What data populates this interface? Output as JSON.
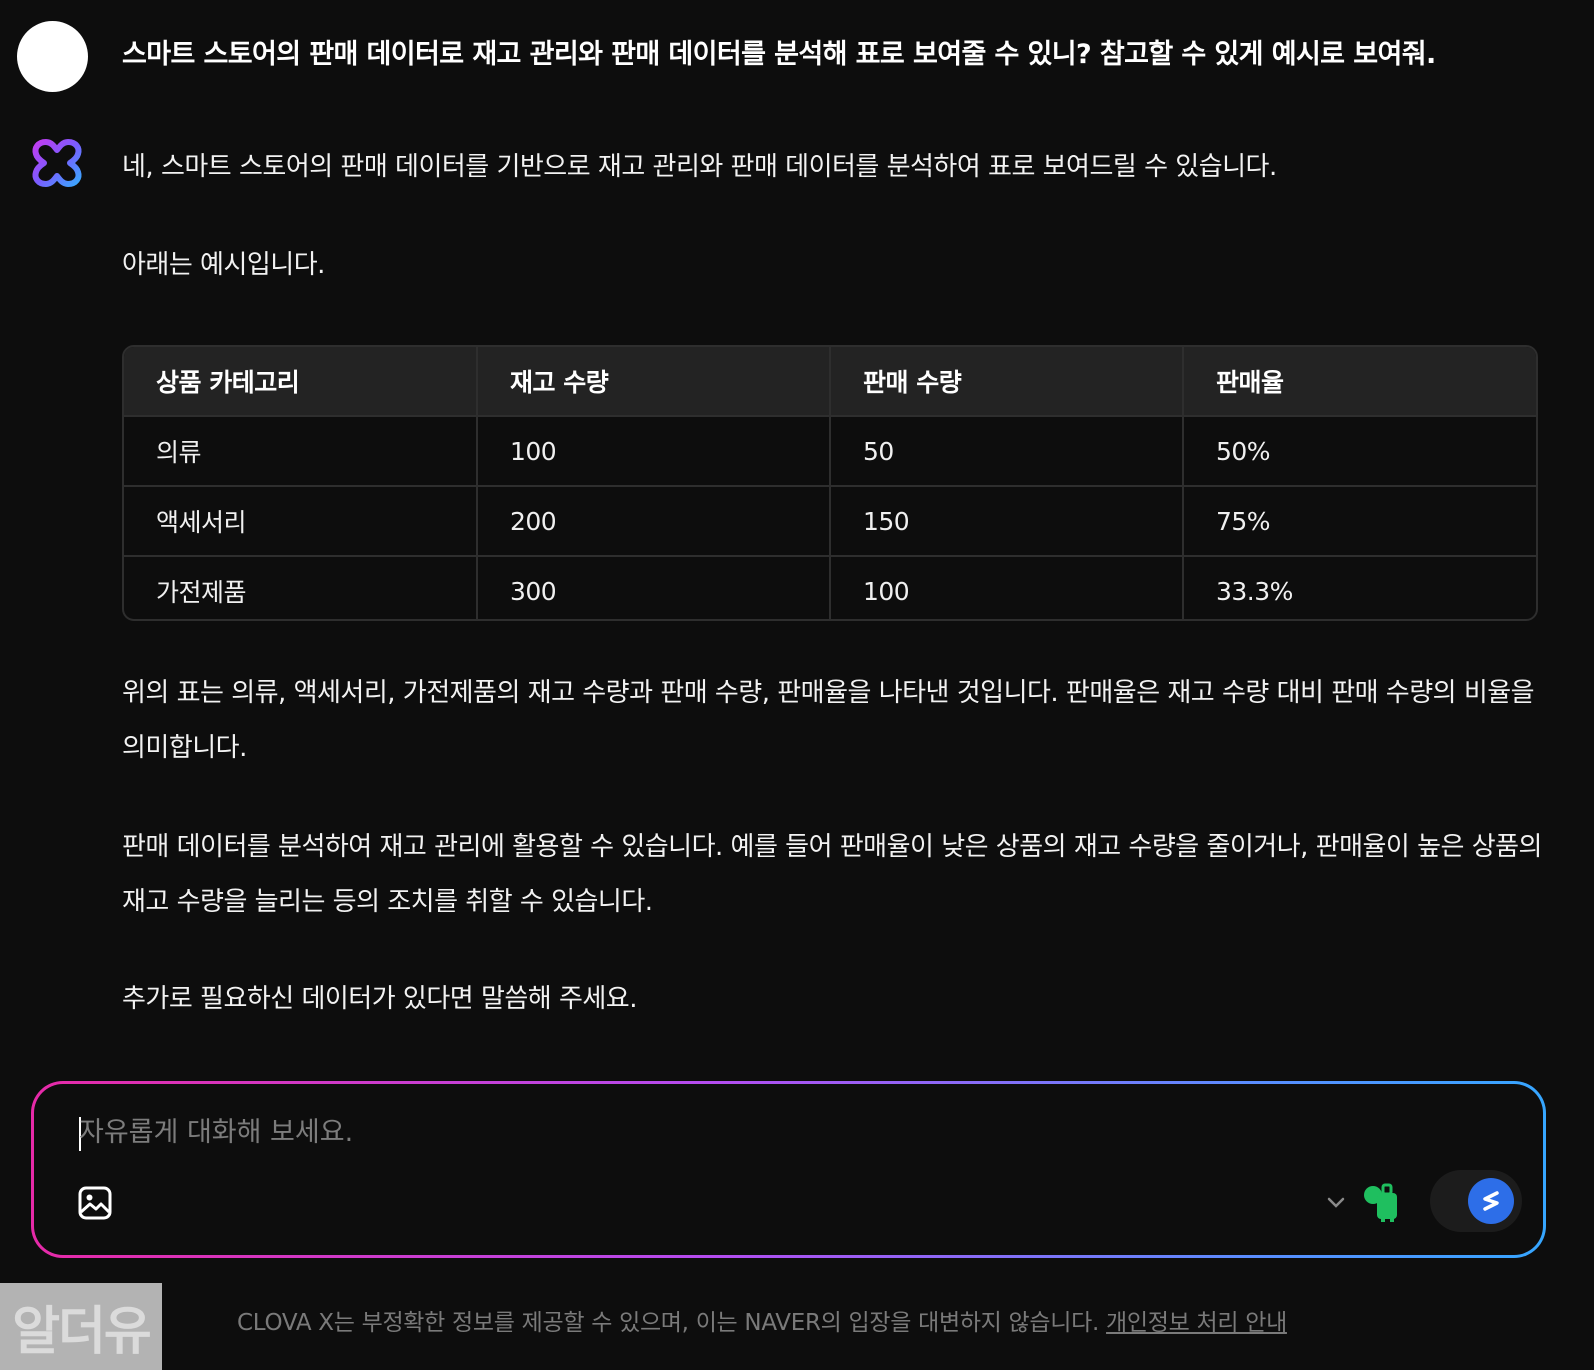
{
  "user_message": "스마트 스토어의 판매 데이터로 재고 관리와 판매 데이터를 분석해 표로 보여줄 수 있니? 참고할 수 있게 예시로 보여줘.",
  "response": {
    "intro": "네, 스마트 스토어의 판매 데이터를 기반으로 재고 관리와 판매 데이터를 분석하여 표로 보여드릴 수 있습니다.",
    "example": "아래는 예시입니다.",
    "table": {
      "headers": [
        "상품 카테고리",
        "재고 수량",
        "판매 수량",
        "판매율"
      ],
      "rows": [
        [
          "의류",
          "100",
          "50",
          "50%"
        ],
        [
          "액세서리",
          "200",
          "150",
          "75%"
        ],
        [
          "가전제품",
          "300",
          "100",
          "33.3%"
        ]
      ]
    },
    "description": "위의 표는 의류, 액세서리, 가전제품의 재고 수량과 판매 수량, 판매율을 나타낸 것입니다. 판매율은 재고 수량 대비 판매 수량의 비율을 의미합니다.",
    "usage": "판매 데이터를 분석하여 재고 관리에 활용할 수 있습니다. 예를 들어 판매율이 낮은 상품의 재고 수량을 줄이거나, 판매율이 높은 상품의 재고 수량을 늘리는 등의 조치를 취할 수 있습니다.",
    "extra": "추가로 필요하신 데이터가 있다면 말씀해 주세요."
  },
  "input": {
    "placeholder": "자유롭게 대화해 보세요.",
    "value": ""
  },
  "icons": {
    "image": "image-icon",
    "chevron": "chevron-down-icon",
    "skill": "skill-plugin-icon",
    "send": "send-icon",
    "logo": "clova-x-logo-icon"
  },
  "colors": {
    "background": "#0d0d0d",
    "table_border": "#2e2e2e",
    "table_header_bg": "#232323",
    "input_gradient_start": "#e62aa8",
    "input_gradient_end": "#36a6ff",
    "send_button": "#2d6ee8",
    "skill_icon": "#1fbf5f"
  },
  "watermark": "알더유",
  "footer": {
    "disclaimer": "CLOVA X는 부정확한 정보를 제공할 수 있으며, 이는 NAVER의 입장을 대변하지 않습니다.",
    "link": "개인정보 처리 안내"
  }
}
